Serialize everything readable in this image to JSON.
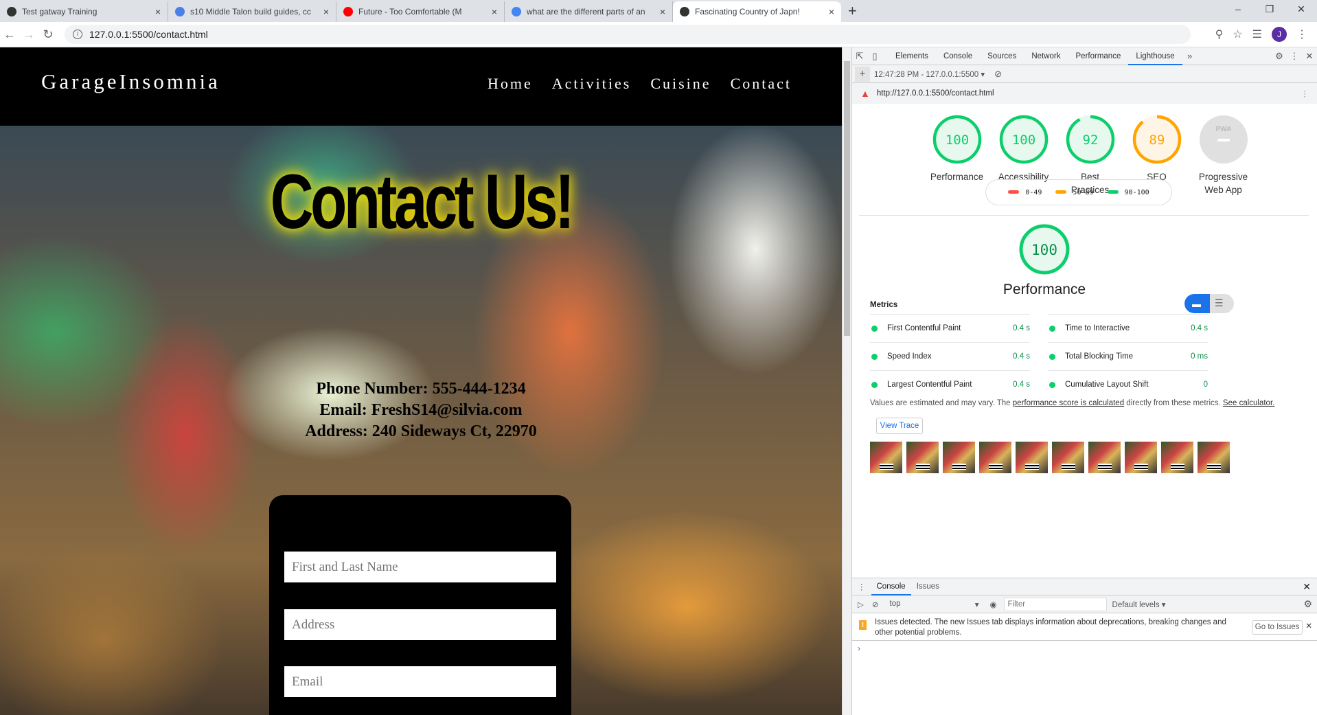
{
  "browser": {
    "tabs": [
      {
        "title": "Test gatway Training",
        "icon": "globe-icon",
        "active": false
      },
      {
        "title": "s10 Middle Talon build guides, cc",
        "icon": "doc-icon",
        "active": false
      },
      {
        "title": "Future - Too Comfortable (M",
        "icon": "youtube-icon",
        "active": false
      },
      {
        "title": "what are the different parts of an",
        "icon": "google-icon",
        "active": false
      },
      {
        "title": "Fascinating Country of Japn!",
        "icon": "globe-icon",
        "active": true
      }
    ],
    "url": "127.0.0.1:5500/contact.html",
    "profile_initial": "J"
  },
  "site": {
    "logo": "GarageInsomnia",
    "nav": [
      "Home",
      "Activities",
      "Cuisine",
      "Contact"
    ],
    "title": "Contact Us!",
    "phone": "Phone Number: 555-444-1234",
    "email": "Email: FreshS14@silvia.com",
    "address": "Address: 240 Sideways Ct, 22970",
    "form": {
      "name_placeholder": "First and Last Name",
      "address_placeholder": "Address",
      "email_placeholder": "Email"
    }
  },
  "devtools": {
    "tabs": [
      "Elements",
      "Console",
      "Sources",
      "Network",
      "Performance",
      "Lighthouse"
    ],
    "report_select": "12:47:28 PM - 127.0.0.1:5500",
    "report_url": "http://127.0.0.1:5500/contact.html",
    "scores": [
      {
        "label1": "Performance",
        "label2": "",
        "score": 100,
        "color": "#0cce6b",
        "bg": "#e7f9ef"
      },
      {
        "label1": "Accessibility",
        "label2": "",
        "score": 100,
        "color": "#0cce6b",
        "bg": "#e7f9ef"
      },
      {
        "label1": "Best",
        "label2": "Practices",
        "score": 92,
        "color": "#0cce6b",
        "bg": "#e7f9ef"
      },
      {
        "label1": "SEO",
        "label2": "",
        "score": 89,
        "color": "#ffa400",
        "bg": "#fff5e6"
      },
      {
        "label1": "Progressive",
        "label2": "Web App",
        "score": null,
        "pwa": "PWA",
        "color": "#ddd",
        "bg": "#e0e0e0"
      }
    ],
    "legend": [
      {
        "label": "0-49",
        "color": "#ff4e42"
      },
      {
        "label": "50-89",
        "color": "#ffa400"
      },
      {
        "label": "90-100",
        "color": "#0cce6b"
      }
    ],
    "main_score": {
      "score": 100,
      "label": "Performance"
    },
    "metrics_title": "Metrics",
    "metrics": [
      {
        "name": "First Contentful Paint",
        "value": "0.4 s"
      },
      {
        "name": "Time to Interactive",
        "value": "0.4 s"
      },
      {
        "name": "Speed Index",
        "value": "0.4 s"
      },
      {
        "name": "Total Blocking Time",
        "value": "0 ms"
      },
      {
        "name": "Largest Contentful Paint",
        "value": "0.4 s"
      },
      {
        "name": "Cumulative Layout Shift",
        "value": "0"
      }
    ],
    "note_pre": "Values are estimated and may vary. The ",
    "note_link": "performance score is calculated",
    "note_mid": " directly from these metrics. ",
    "note_link2": "See calculator.",
    "view_trace": "View Trace",
    "drawer_tabs": [
      "Console",
      "Issues"
    ],
    "context": "top",
    "filter_placeholder": "Filter",
    "levels": "Default levels ▾",
    "issue_text": "Issues detected. The new Issues tab displays information about deprecations, breaking changes and other potential problems.",
    "goto_issues": "Go to Issues"
  }
}
